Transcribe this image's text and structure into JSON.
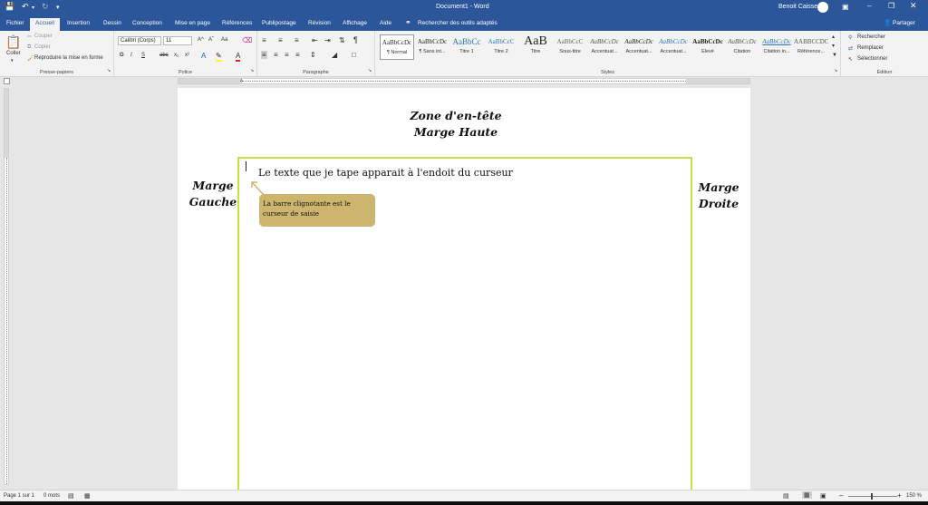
{
  "titlebar": {
    "title": "Document1 - Word",
    "user": "Benoit Caisse"
  },
  "tabs": [
    "Fichier",
    "Accueil",
    "Insertion",
    "Dessin",
    "Conception",
    "Mise en page",
    "Références",
    "Publipostage",
    "Révision",
    "Affichage",
    "Aide"
  ],
  "tell_me": "Rechercher des outils adaptés",
  "share": "Partager",
  "clipboard": {
    "paste": "Coller",
    "cut": "Couper",
    "copy": "Copier",
    "format_painter": "Reproduire la mise en forme",
    "label": "Presse-papiers"
  },
  "font": {
    "name": "Calibri (Corps)",
    "size": "11",
    "bold": "G",
    "italic": "I",
    "underline": "S",
    "strike": "abc",
    "sub": "x₂",
    "sup": "x²",
    "grow": "A^",
    "shrink": "Aˇ",
    "case": "Aa",
    "label": "Police"
  },
  "paragraph": {
    "label": "Paragraphe"
  },
  "styles": {
    "label": "Styles",
    "items": [
      {
        "preview": "AaBbCcDc",
        "name": "¶ Normal"
      },
      {
        "preview": "AaBbCcDc",
        "name": "¶ Sans int..."
      },
      {
        "preview": "AaBbCc",
        "name": "Titre 1"
      },
      {
        "preview": "AaBbCcC",
        "name": "Titre 2"
      },
      {
        "preview": "AaB",
        "name": "Titre"
      },
      {
        "preview": "AaBbCcC",
        "name": "Sous-titre"
      },
      {
        "preview": "AaBbCcDc",
        "name": "Accentuat..."
      },
      {
        "preview": "AaBbCcDc",
        "name": "Accentuat..."
      },
      {
        "preview": "AaBbCcDc",
        "name": "Accentuat..."
      },
      {
        "preview": "AaBbCcDc",
        "name": "Élevé"
      },
      {
        "preview": "AaBbCcDc",
        "name": "Citation"
      },
      {
        "preview": "AaBbCcDc",
        "name": "Citation in..."
      },
      {
        "preview": "AABBCCDC",
        "name": "Référence..."
      }
    ]
  },
  "edition": {
    "find": "Rechercher",
    "replace": "Remplacer",
    "select": "Sélectionner",
    "label": "Édition"
  },
  "document": {
    "header_line1": "Zone d'en-tête",
    "header_line2": "Marge Haute",
    "left_line1": "Marge",
    "left_line2": "Gauche",
    "right_line1": "Marge",
    "right_line2": "Droite",
    "body_text": "Le texte que je tape apparait à l'endoit du curseur",
    "callout": "La barre clignotante est le curseur de saisie"
  },
  "status": {
    "page": "Page 1 sur 1",
    "words": "0 mots",
    "zoom": "150 %"
  },
  "colors": {
    "accent": "#2b579a",
    "textbox_border": "#c6e048",
    "callout_fill": "#cdb56e"
  }
}
